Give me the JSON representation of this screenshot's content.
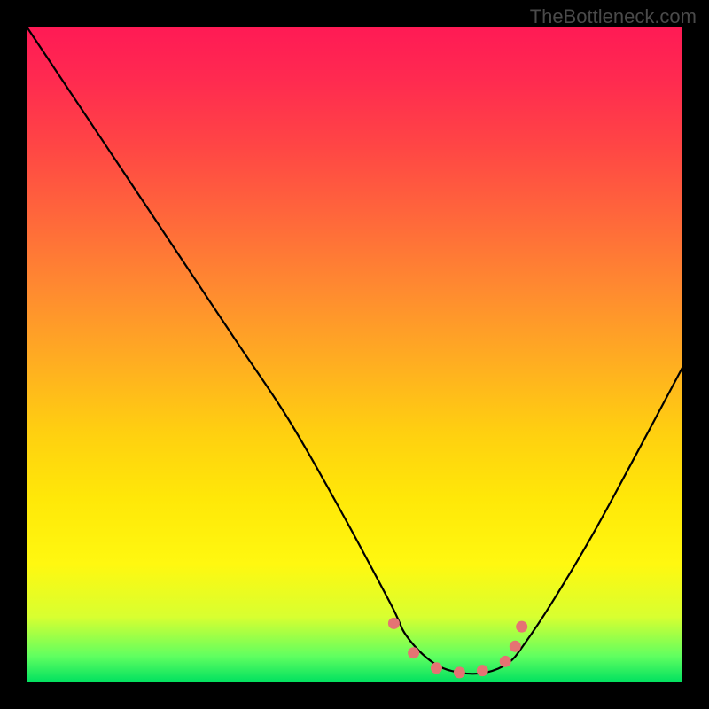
{
  "watermark": "TheBottleneck.com",
  "chart_data": {
    "type": "line",
    "title": "",
    "xlabel": "",
    "ylabel": "",
    "xlim": [
      0,
      100
    ],
    "ylim": [
      0,
      100
    ],
    "series": [
      {
        "name": "curve",
        "x": [
          0,
          8,
          16,
          24,
          32,
          40,
          48,
          55.5,
          58,
          62,
          66,
          70,
          73.5,
          76,
          80,
          86,
          92,
          100
        ],
        "y": [
          100,
          88,
          76,
          64,
          52,
          40,
          26,
          12,
          7,
          3,
          1.5,
          1.5,
          3,
          6,
          12,
          22,
          33,
          48
        ],
        "color": "#000000"
      }
    ],
    "markers": [
      {
        "x": 56,
        "y": 9,
        "color": "#e57373"
      },
      {
        "x": 59,
        "y": 4.5,
        "color": "#e57373"
      },
      {
        "x": 62.5,
        "y": 2.2,
        "color": "#e57373"
      },
      {
        "x": 66,
        "y": 1.5,
        "color": "#e57373"
      },
      {
        "x": 69.5,
        "y": 1.8,
        "color": "#e57373"
      },
      {
        "x": 73,
        "y": 3.2,
        "color": "#e57373"
      },
      {
        "x": 74.5,
        "y": 5.5,
        "color": "#e57373"
      },
      {
        "x": 75.5,
        "y": 8.5,
        "color": "#e57373"
      }
    ],
    "gradient_stops": [
      {
        "pos": 0,
        "color": "#ff1a55"
      },
      {
        "pos": 50,
        "color": "#ffc818"
      },
      {
        "pos": 85,
        "color": "#fff810"
      },
      {
        "pos": 100,
        "color": "#00e060"
      }
    ]
  }
}
